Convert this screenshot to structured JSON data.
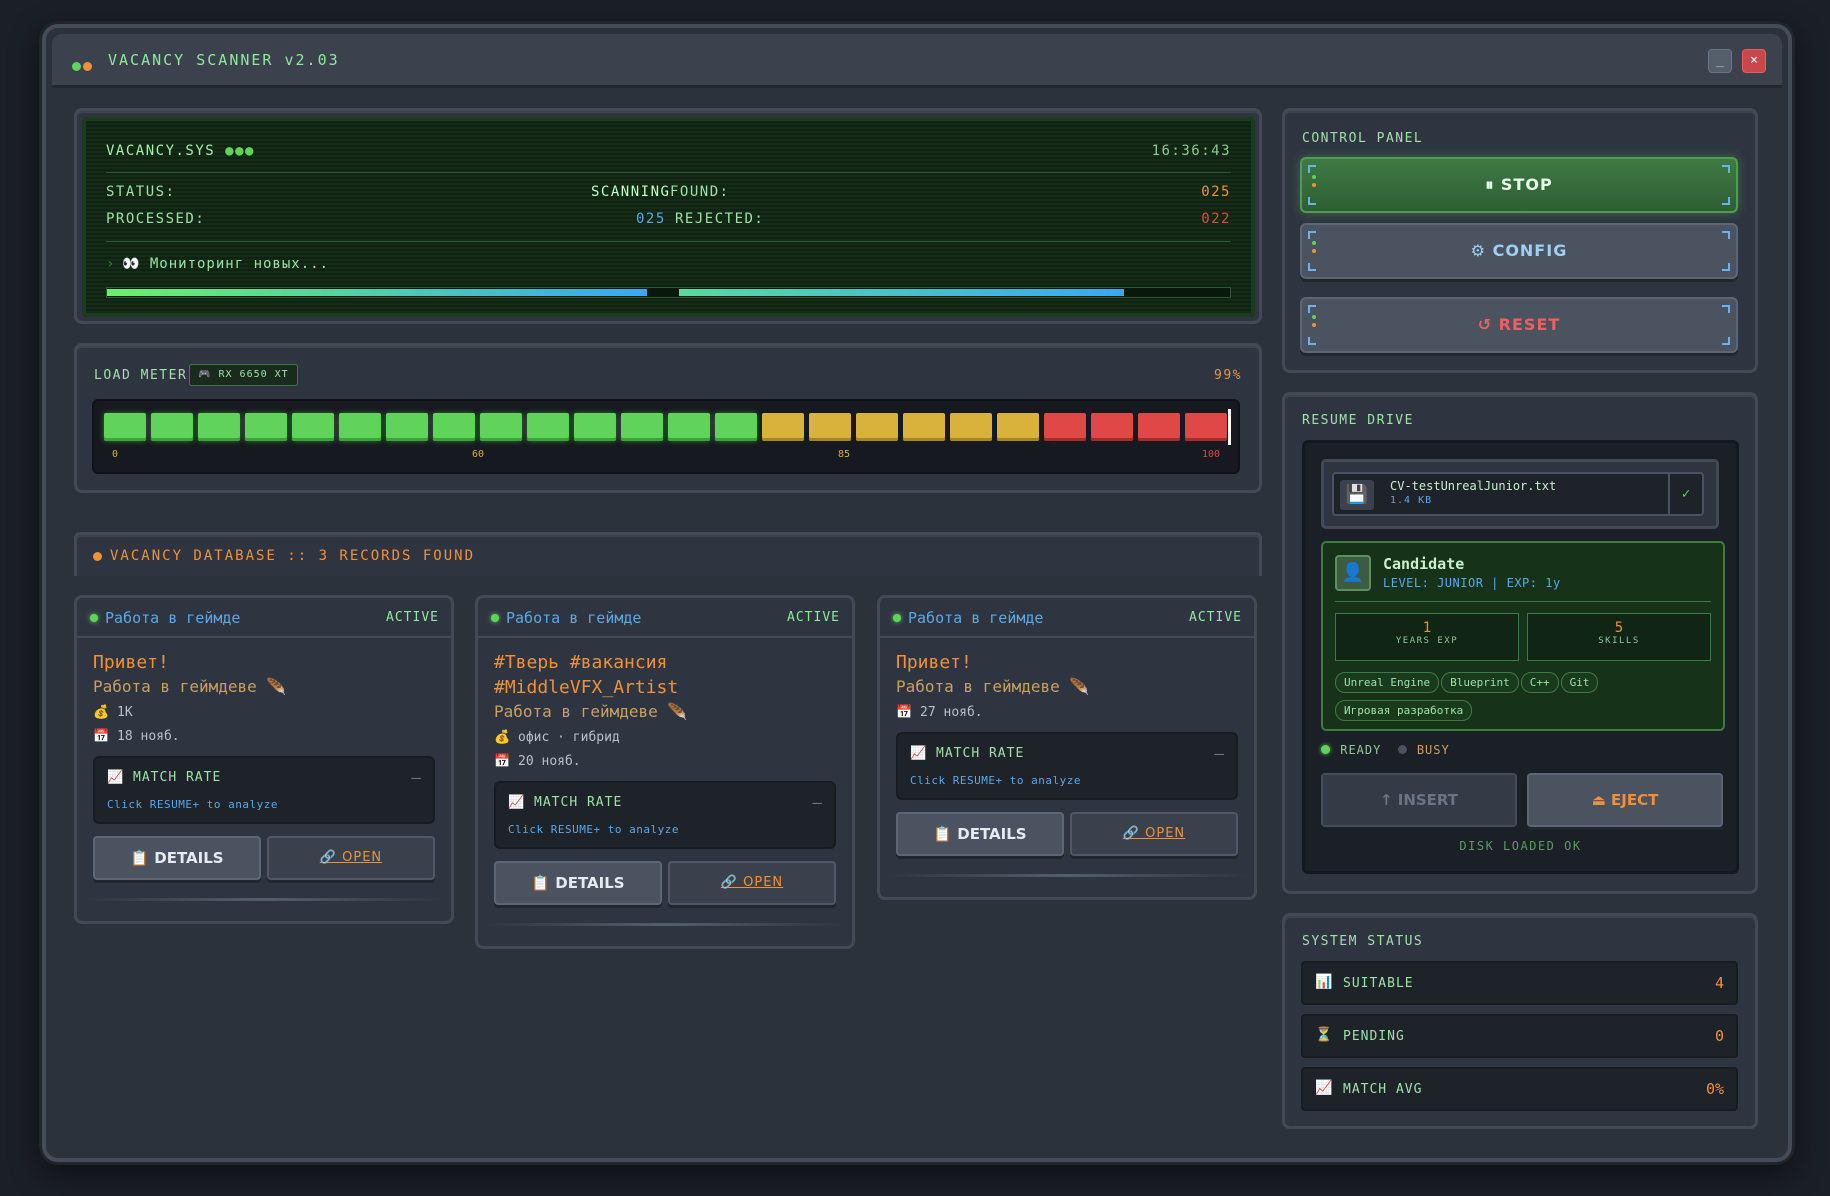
{
  "window": {
    "title": "VACANCY SCANNER v2.03",
    "min_label": "_",
    "close_label": "×"
  },
  "terminal": {
    "name": "VACANCY.SYS",
    "dots": "●●●",
    "time": "16:36:43",
    "status_label": "STATUS:",
    "status_value": "SCANNING",
    "found_label": "FOUND:",
    "found_value": "025",
    "processed_label": "PROCESSED:",
    "processed_value": "025",
    "rejected_label": "REJECTED:",
    "rejected_value": "022",
    "prompt": "›",
    "message": "👀 Мониторинг новых...",
    "progress_a": 0.48,
    "progress_b": 0.9
  },
  "load_meter": {
    "label": "LOAD METER",
    "gpu_icon": "gpu-icon",
    "gpu": "RX 6650 XT",
    "percent_label": "99%",
    "value": 99,
    "ticks": [
      "0",
      "60",
      "85",
      "100"
    ]
  },
  "database": {
    "title": "VACANCY DATABASE :: 3 RECORDS FOUND"
  },
  "cards": [
    {
      "source": "Работа в геймде",
      "status": "ACTIVE",
      "title": "Привет!",
      "subtitle": "Работа в геймдеве 🪶",
      "rows": [
        {
          "icon": "💰",
          "text": "1K"
        },
        {
          "icon": "📅",
          "text": "18 нояб."
        }
      ],
      "match_label": "MATCH RATE",
      "match_value": "—",
      "match_hint": "Click RESUME+ to analyze",
      "details": "📋 DETAILS",
      "open": "🔗 OPEN"
    },
    {
      "source": "Работа в геймде",
      "status": "ACTIVE",
      "title": "#Тверь #вакансия\n#MiddleVFX_Artist",
      "subtitle": "Работа в геймдеве 🪶",
      "rows": [
        {
          "icon": "💰",
          "text": "офис · гибрид"
        },
        {
          "icon": "📅",
          "text": "20 нояб."
        }
      ],
      "match_label": "MATCH RATE",
      "match_value": "—",
      "match_hint": "Click RESUME+ to analyze",
      "details": "📋 DETAILS",
      "open": "🔗 OPEN"
    },
    {
      "source": "Работа в геймде",
      "status": "ACTIVE",
      "title": "Привет!",
      "subtitle": "Работа в геймдеве 🪶",
      "rows": [
        {
          "icon": "📅",
          "text": "27 нояб."
        }
      ],
      "match_label": "MATCH RATE",
      "match_value": "—",
      "match_hint": "Click RESUME+ to analyze",
      "details": "📋 DETAILS",
      "open": "🔗 OPEN"
    }
  ],
  "control_panel": {
    "label": "CONTROL PANEL",
    "stop": "⏸ STOP",
    "config": "⚙ CONFIG",
    "reset": "↺ RESET"
  },
  "resume_drive": {
    "label": "RESUME DRIVE",
    "disk_icon": "💾",
    "file_name": "CV-testUnrealJunior.txt",
    "file_size": "1.4 KB",
    "check": "✓",
    "candidate_icon": "👤",
    "candidate_name": "Candidate",
    "candidate_meta": "LEVEL: JUNIOR | EXP: 1y",
    "years_value": "1",
    "years_label": "YEARS EXP",
    "skills_value": "5",
    "skills_label": "SKILLS",
    "tags": [
      "Unreal Engine",
      "Blueprint",
      "C++",
      "Git",
      "Игровая разработка"
    ],
    "ready": "READY",
    "busy": "BUSY",
    "insert": "↑ INSERT",
    "eject": "⏏ EJECT",
    "disk_status": "DISK LOADED OK"
  },
  "system_status": {
    "label": "SYSTEM STATUS",
    "items": [
      {
        "icon": "📊",
        "label": "SUITABLE",
        "value": "4"
      },
      {
        "icon": "⏳",
        "label": "PENDING",
        "value": "0"
      },
      {
        "icon": "📈",
        "label": "MATCH AVG",
        "value": "0%"
      }
    ]
  },
  "colors": {
    "accent_green": "#5fd35a",
    "accent_orange": "#f0913a",
    "accent_blue": "#5aa8e8",
    "accent_red": "#e04848"
  }
}
